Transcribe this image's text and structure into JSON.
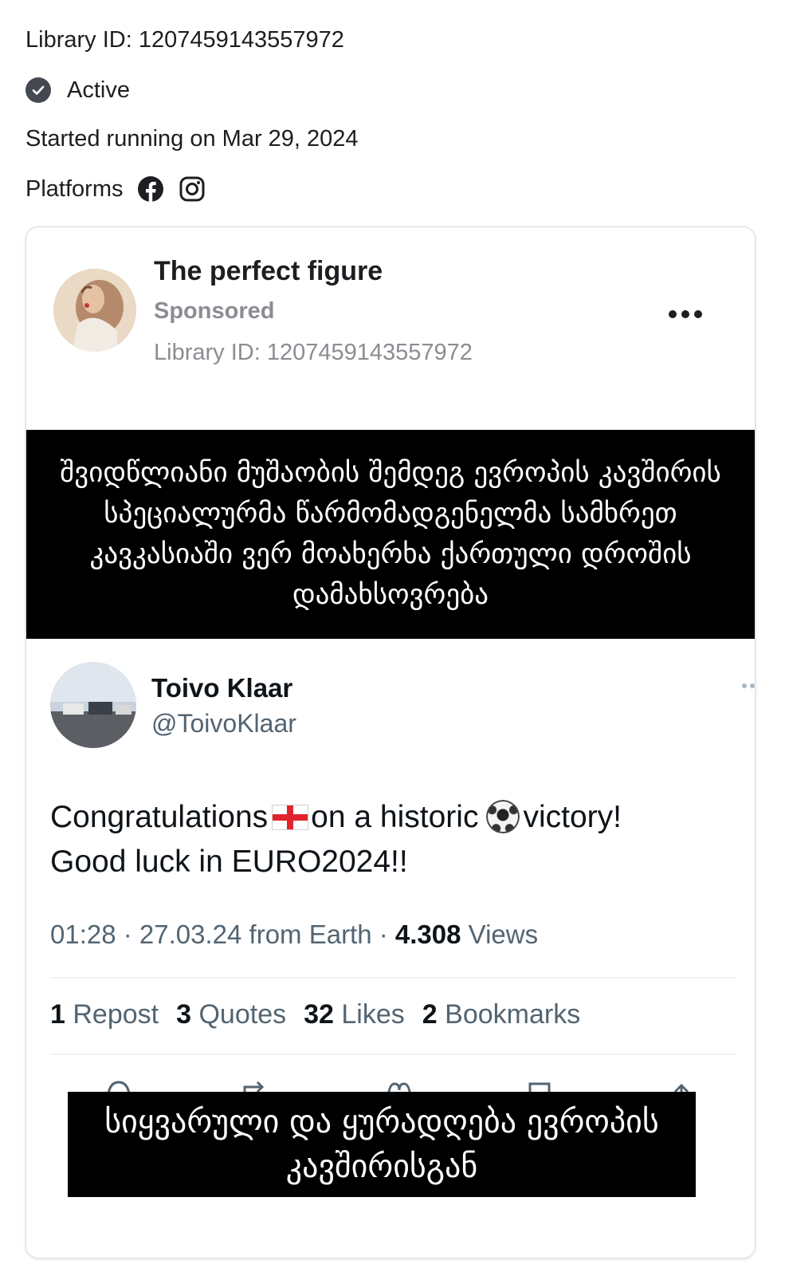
{
  "ad_meta": {
    "library_id": "Library ID: 1207459143557972",
    "status": "Active",
    "started": "Started running on Mar 29, 2024",
    "platforms_label": "Platforms",
    "platform_icons": [
      "facebook-icon",
      "instagram-icon"
    ]
  },
  "ad_card": {
    "page_name": "The perfect figure",
    "sponsored": "Sponsored",
    "library_id": "Library ID: 1207459143557972",
    "more_icon": "more-options-icon"
  },
  "creative": {
    "top_banner": "შვიდწლიანი მუშაობის შემდეგ ევროპის კავშირის სპეციალურმა წარმომადგენელმა სამხრეთ კავკასიაში ვერ მოახერხა ქართული დროშის დამახსოვრება",
    "tweet": {
      "name": "Toivo Klaar",
      "handle": "@ToivoKlaar",
      "text_part1": "Congratulations",
      "text_part2": "on a historic",
      "text_part3": "victory!",
      "text_line2": "Good luck in EURO2024!!",
      "meta_prefix": "01:28 · 27.03.24 from Earth ·",
      "views_count": "4.308",
      "views_label": "Views",
      "stats": [
        {
          "count": "1",
          "label": "Repost"
        },
        {
          "count": "3",
          "label": "Quotes"
        },
        {
          "count": "32",
          "label": "Likes"
        },
        {
          "count": "2",
          "label": "Bookmarks"
        }
      ]
    },
    "bottom_banner": "სიყვარული და ყურადღება ევროპის კავშირისგან"
  },
  "colors": {
    "text_primary": "#1c1e21",
    "text_secondary": "#8a8d91",
    "status_icon": "#444950",
    "banner_bg": "#000000",
    "twitter_secondary": "#536471"
  }
}
